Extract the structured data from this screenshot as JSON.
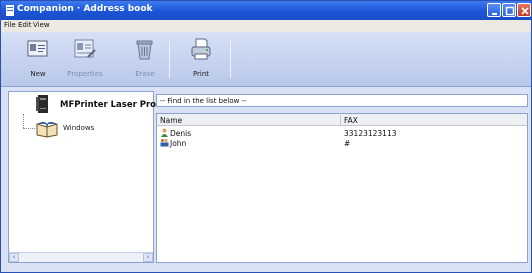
{
  "window": {
    "title": "Companion · Address book"
  },
  "menu": [
    {
      "label": "File"
    },
    {
      "label": "Edit"
    },
    {
      "label": "View"
    }
  ],
  "toolbar": {
    "new_label": "New",
    "properties_label": "Properties",
    "erase_label": "Erase",
    "print_label": "Print"
  },
  "tree": {
    "printer_label": "MFPrinter Laser Pro LL",
    "windows_label": "Windows"
  },
  "find": {
    "text": "-- Find in the list below --"
  },
  "list": {
    "columns": [
      "Name",
      "FAX"
    ],
    "rows": [
      {
        "name": "Denis",
        "fax": "33123123113",
        "icon": "contact-person-icon"
      },
      {
        "name": "John",
        "fax": "#",
        "icon": "contact-group-icon"
      }
    ]
  },
  "colors": {
    "titlebar": "#1b54d6",
    "toolbar": "#c7d4f0",
    "close_button": "#c6381f"
  }
}
